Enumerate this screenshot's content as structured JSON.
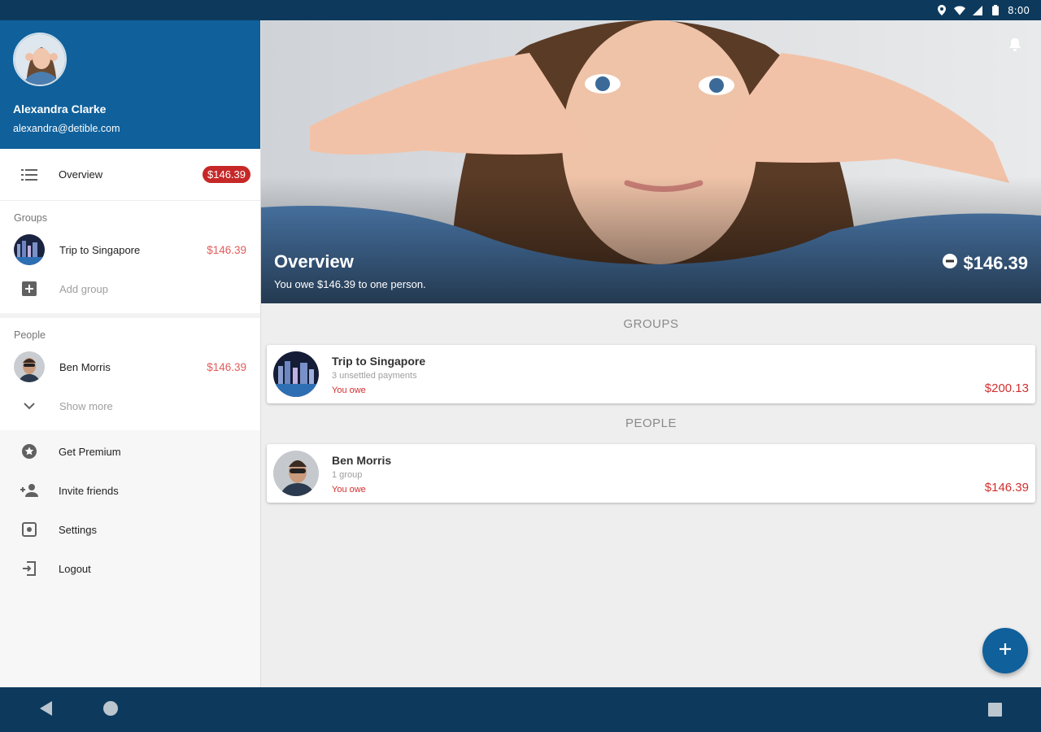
{
  "status_bar": {
    "time": "8:00"
  },
  "drawer": {
    "user": {
      "name": "Alexandra Clarke",
      "email": "alexandra@detible.com"
    },
    "overview": {
      "label": "Overview",
      "badge": "$146.39"
    },
    "groups": {
      "title": "Groups",
      "items": [
        {
          "label": "Trip to Singapore",
          "amount": "$146.39"
        }
      ],
      "add_label": "Add group"
    },
    "people": {
      "title": "People",
      "items": [
        {
          "label": "Ben Morris",
          "amount": "$146.39"
        }
      ],
      "more_label": "Show more"
    },
    "menu": [
      {
        "label": "Get Premium",
        "icon": "star-circle-icon"
      },
      {
        "label": "Invite friends",
        "icon": "person-add-icon"
      },
      {
        "label": "Settings",
        "icon": "settings-icon"
      },
      {
        "label": "Logout",
        "icon": "logout-icon"
      }
    ]
  },
  "hero": {
    "title": "Overview",
    "subtitle": "You owe $146.39 to one person.",
    "amount": "$146.39"
  },
  "main": {
    "groups_header": "GROUPS",
    "groups": [
      {
        "title": "Trip to Singapore",
        "subtitle": "3 unsettled payments",
        "status": "You owe",
        "amount": "$200.13"
      }
    ],
    "people_header": "PEOPLE",
    "people": [
      {
        "title": "Ben Morris",
        "subtitle": "1 group",
        "status": "You owe",
        "amount": "$146.39"
      }
    ]
  },
  "colors": {
    "primary": "#0f609b",
    "status_bar": "#0d3a5c",
    "negative": "#d32f2f",
    "badge": "#c62828"
  }
}
